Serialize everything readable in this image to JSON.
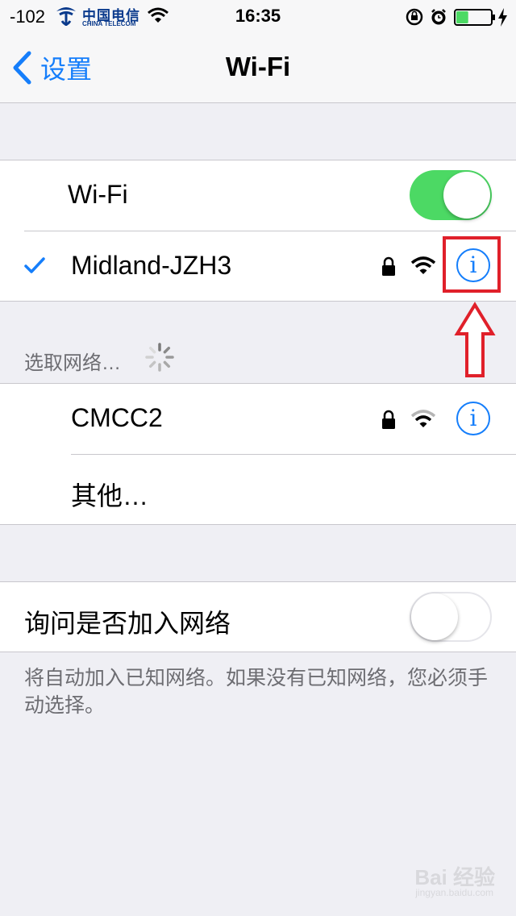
{
  "status_bar": {
    "signal": "-102",
    "carrier_cn": "中国电信",
    "carrier_en": "CHINA TELECOM",
    "time": "16:35",
    "battery_level": 0.35,
    "battery_color": "#4cd964"
  },
  "nav": {
    "back_label": "设置",
    "title": "Wi-Fi"
  },
  "wifi_group": {
    "toggle_label": "Wi-Fi",
    "toggle_on": true,
    "connected_network": "Midland-JZH3"
  },
  "choose_network": {
    "header": "选取网络…",
    "networks": [
      {
        "name": "CMCC2",
        "secured": true
      }
    ],
    "other_label": "其他…"
  },
  "ask_join": {
    "label": "询问是否加入网络",
    "toggle_on": false,
    "footer": "将自动加入已知网络。如果没有已知网络，您必须手动选择。"
  },
  "info_glyph": "i",
  "watermark": {
    "text": "Bai 经验",
    "sub": "jingyan.baidu.com"
  },
  "colors": {
    "accent": "#157efb",
    "toggle_on": "#4cd964",
    "highlight": "#e0202a",
    "background": "#efeff4"
  }
}
